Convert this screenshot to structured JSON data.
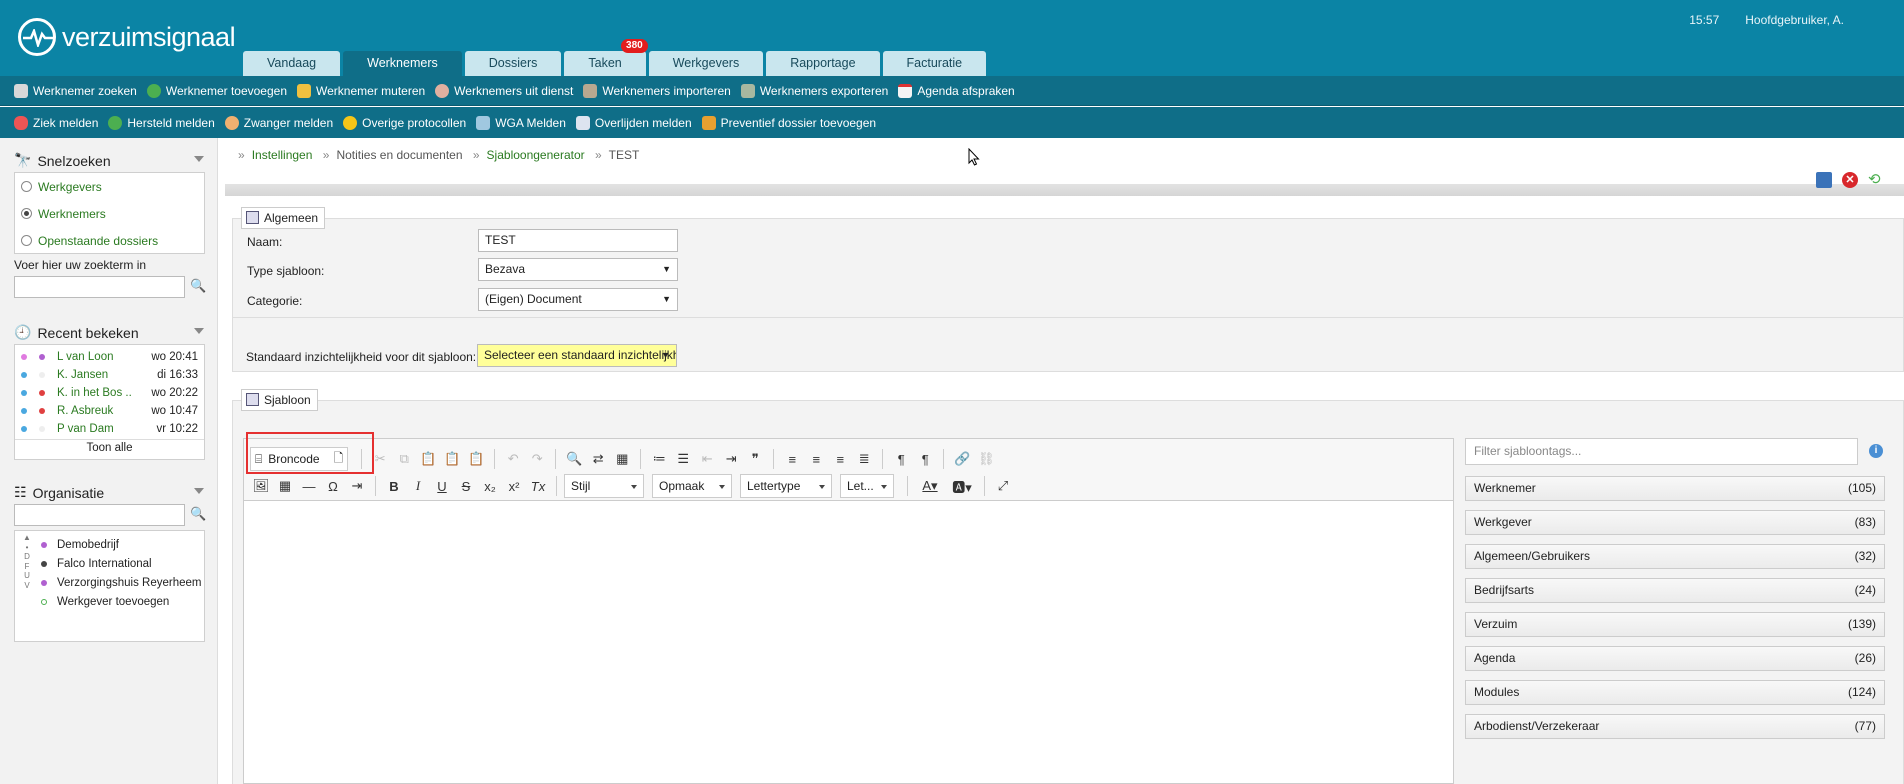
{
  "app": {
    "logo": "verzuimsignaal",
    "time": "15:57",
    "user": "Hoofdgebruiker, A."
  },
  "tabs": [
    {
      "label": "Vandaag"
    },
    {
      "label": "Werknemers",
      "active": true
    },
    {
      "label": "Dossiers"
    },
    {
      "label": "Taken",
      "badge": "380"
    },
    {
      "label": "Werkgevers"
    },
    {
      "label": "Rapportage"
    },
    {
      "label": "Facturatie"
    }
  ],
  "toolbar1": [
    "Werknemer zoeken",
    "Werknemer toevoegen",
    "Werknemer muteren",
    "Werknemers uit dienst",
    "Werknemers importeren",
    "Werknemers exporteren",
    "Agenda afspraken"
  ],
  "toolbar2": [
    "Ziek melden",
    "Hersteld melden",
    "Zwanger melden",
    "Overige protocollen",
    "WGA Melden",
    "Overlijden melden",
    "Preventief dossier toevoegen"
  ],
  "sidebar": {
    "snelzoeken": {
      "title": "Snelzoeken",
      "options": [
        "Werkgevers",
        "Werknemers",
        "Openstaande dossiers"
      ],
      "hint": "Voer hier uw zoekterm in"
    },
    "recent": {
      "title": "Recent bekeken",
      "items": [
        {
          "name": "L van Loon",
          "time": "wo 20:41"
        },
        {
          "name": "K. Jansen",
          "time": "di 16:33"
        },
        {
          "name": "K. in het Bos ..",
          "time": "wo 20:22"
        },
        {
          "name": "R. Asbreuk",
          "time": "wo 10:47"
        },
        {
          "name": "P van Dam",
          "time": "vr 10:22"
        }
      ],
      "show_all": "Toon alle"
    },
    "org": {
      "title": "Organisatie",
      "items": [
        "Demobedrijf",
        "Falco International",
        "Verzorgingshuis Reyerheem",
        "Werkgever toevoegen"
      ],
      "letters": [
        "D",
        "F",
        "U",
        "V"
      ]
    }
  },
  "breadcrumb": [
    "Instellingen",
    "Notities en documenten",
    "Sjabloongenerator",
    "TEST"
  ],
  "algemeen": {
    "legend": "Algemeen",
    "fields": [
      {
        "label": "Naam:",
        "value": "TEST"
      },
      {
        "label": "Type sjabloon:",
        "value": "Bezava"
      },
      {
        "label": "Categorie:",
        "value": "(Eigen) Document"
      },
      {
        "label": "Standaard inzichtelijkheid voor dit sjabloon:",
        "value": "Selecteer een standaard inzichtelijkh"
      }
    ]
  },
  "sjabloon": {
    "legend": "Sjabloon",
    "source_button": "Broncode",
    "dropdowns": [
      "Stijl",
      "Opmaak",
      "Lettertype",
      "Let..."
    ]
  },
  "tags": {
    "filter_placeholder": "Filter sjabloontags...",
    "items": [
      {
        "name": "Werknemer",
        "count": "(105)"
      },
      {
        "name": "Werkgever",
        "count": "(83)"
      },
      {
        "name": "Algemeen/Gebruikers",
        "count": "(32)"
      },
      {
        "name": "Bedrijfsarts",
        "count": "(24)"
      },
      {
        "name": "Verzuim",
        "count": "(139)"
      },
      {
        "name": "Agenda",
        "count": "(26)"
      },
      {
        "name": "Modules",
        "count": "(124)"
      },
      {
        "name": "Arbodienst/Verzekeraar",
        "count": "(77)"
      }
    ]
  },
  "colors": {
    "brand": "#0b84a5",
    "bar": "#0f6e88",
    "link": "#2a7a20",
    "highlight": "#e53030"
  }
}
